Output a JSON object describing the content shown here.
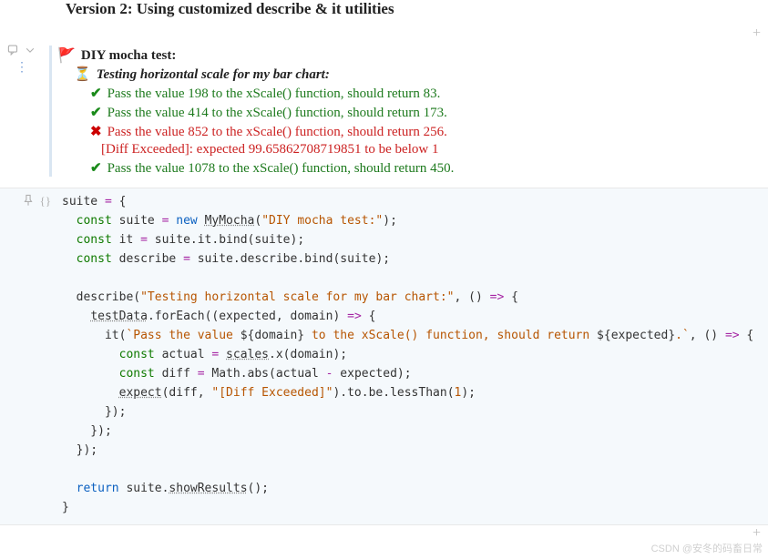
{
  "heading": "Version 2: Using customized describe & it utilities",
  "output": {
    "suite_title": "DIY mocha test:",
    "describe_title": "Testing horizontal scale for my bar chart:",
    "tests": [
      {
        "status": "pass",
        "text": "Pass the value 198 to the xScale() function, should return 83."
      },
      {
        "status": "pass",
        "text": "Pass the value 414 to the xScale() function, should return 173."
      },
      {
        "status": "fail",
        "text": "Pass the value 852 to the xScale() function, should return 256.",
        "error": "[Diff Exceeded]: expected 99.65862708719851 to be below 1"
      },
      {
        "status": "pass",
        "text": "Pass the value 1078 to the xScale() function, should return 450."
      }
    ]
  },
  "code": {
    "var_suite": "suite",
    "const_kw": "const",
    "new_kw": "new",
    "return_kw": "return",
    "class_my_mocha": "MyMocha",
    "str_suite_title": "\"DIY mocha test:\"",
    "var_it": "it",
    "var_describe": "describe",
    "fn_bind": "bind",
    "str_describe_title": "\"Testing horizontal scale for my bar chart:\"",
    "ident_testData": "testData",
    "fn_forEach": "forEach",
    "param_expected": "expected",
    "param_domain": "domain",
    "tmpl_prefix": "`Pass the value ",
    "tmpl_domain": "${domain}",
    "tmpl_mid": " to the xScale() function, should return ",
    "tmpl_expected": "${expected}",
    "tmpl_suffix": ".`",
    "var_actual": "actual",
    "ident_scales": "scales",
    "fn_x": "x",
    "var_diff": "diff",
    "ident_Math": "Math",
    "fn_abs": "abs",
    "ident_expect": "expect",
    "str_diff_exceeded": "\"[Diff Exceeded]\"",
    "chain_to": "to",
    "chain_be": "be",
    "chain_lessThan": "lessThan",
    "num_one": "1",
    "fn_showResults": "showResults"
  },
  "icons": {
    "plus": "+",
    "pin": "📌",
    "braces": "{}",
    "dots": "⋮",
    "flag": "🚩",
    "hourglass": "⏳",
    "check": "✔",
    "cross": "✖"
  },
  "watermark": "CSDN @安冬的码畜日常"
}
